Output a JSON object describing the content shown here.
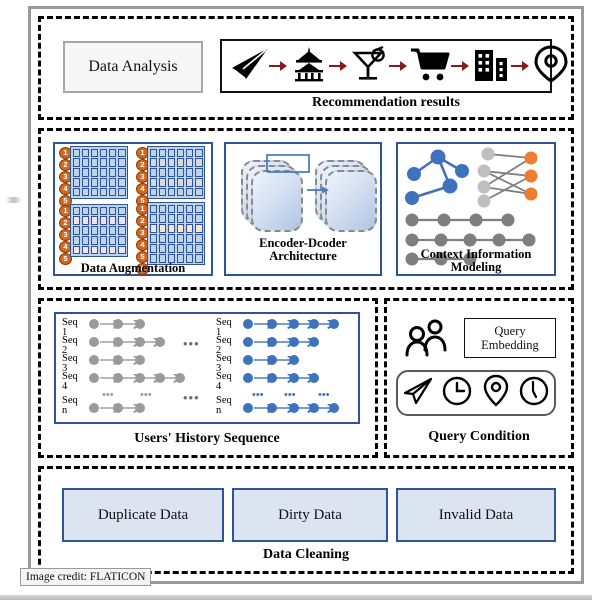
{
  "figure": {
    "credit": "Image credit: FLATICON",
    "colors": {
      "accent_blue": "#2f5597",
      "node_blue": "#3f72bd",
      "node_grey": "#7f7f7f",
      "node_light_grey": "#bfbfbf",
      "node_orange": "#ed7d31",
      "arrow_red": "#8b1a1a",
      "grid_fill": "#bcd3ea",
      "mask_grey": "#d9d9d9",
      "mask_pink": "#f2e2ef",
      "mask_peach": "#fce3cd",
      "box_fill": "#dce4f2",
      "frame_grey": "#9a9a9a"
    }
  },
  "sections": {
    "analysis": {
      "box_label": "Data Analysis",
      "caption": "Recommendation results",
      "icons": [
        "paper-plane-icon",
        "pavilion-icon",
        "cocktail-icon",
        "shopping-cart-icon",
        "buildings-icon",
        "location-pin-icon"
      ]
    },
    "augmentation": {
      "caption": "Data Augmentation",
      "grids": [
        {
          "name": "original-sequence-grid",
          "rows": 5,
          "cols": 6,
          "numbers": [
            "1",
            "2",
            "3",
            "4",
            "5"
          ],
          "masked_rows": [],
          "mask_color": "none"
        },
        {
          "name": "masked-sequence-grid",
          "rows": 5,
          "cols": 6,
          "numbers": [
            "1",
            "2",
            "3",
            "4",
            "5"
          ],
          "masked_rows": [
            2,
            4
          ],
          "mask_color": "grey"
        },
        {
          "name": "reordered-sequence-grid",
          "rows": 5,
          "cols": 6,
          "numbers": [
            "1",
            "2",
            "3",
            "4",
            "5"
          ],
          "masked_rows": [
            2,
            5
          ],
          "mask_color": "pink"
        },
        {
          "name": "inserted-sequence-grid",
          "rows": 6,
          "cols": 6,
          "numbers": [
            "1",
            "2",
            "3",
            "4",
            "5",
            "6"
          ],
          "masked_rows": [
            3
          ],
          "mask_color": "peach"
        }
      ]
    },
    "encoder_decoder": {
      "caption_line1": "Encoder-Dcoder",
      "caption_line2": "Architecture"
    },
    "context": {
      "caption_line1": "Context Information",
      "caption_line2": "Modeling"
    },
    "history": {
      "caption": "Users' History Sequence",
      "ellipsis": "•••",
      "row_dots": "•••",
      "left_rows": [
        {
          "label_line1": "Seq",
          "label_line2": "1",
          "dots": 3
        },
        {
          "label_line1": "Seq",
          "label_line2": "2",
          "dots": 4
        },
        {
          "label_line1": "Seq",
          "label_line2": "3",
          "dots": 3
        },
        {
          "label_line1": "Seq",
          "label_line2": "4",
          "dots": 5
        },
        {
          "label_line1": "Seq",
          "label_line2": "n",
          "dots": 3
        }
      ],
      "right_rows": [
        {
          "label_line1": "Seq",
          "label_line2": "1",
          "dots": 5
        },
        {
          "label_line1": "Seq",
          "label_line2": "2",
          "dots": 4
        },
        {
          "label_line1": "Seq",
          "label_line2": "3",
          "dots": 3
        },
        {
          "label_line1": "Seq",
          "label_line2": "4",
          "dots": 4
        },
        {
          "label_line1": "Seq",
          "label_line2": "n",
          "dots": 5
        }
      ]
    },
    "query": {
      "caption": "Query Condition",
      "embedding_line1": "Query",
      "embedding_line2": "Embedding",
      "icons": [
        "users-icon",
        "paper-plane-icon",
        "clock-icon",
        "location-pin-icon",
        "clock-icon"
      ]
    },
    "cleaning": {
      "caption": "Data Cleaning",
      "boxes": [
        "Duplicate Data",
        "Dirty Data",
        "Invalid Data"
      ]
    }
  }
}
